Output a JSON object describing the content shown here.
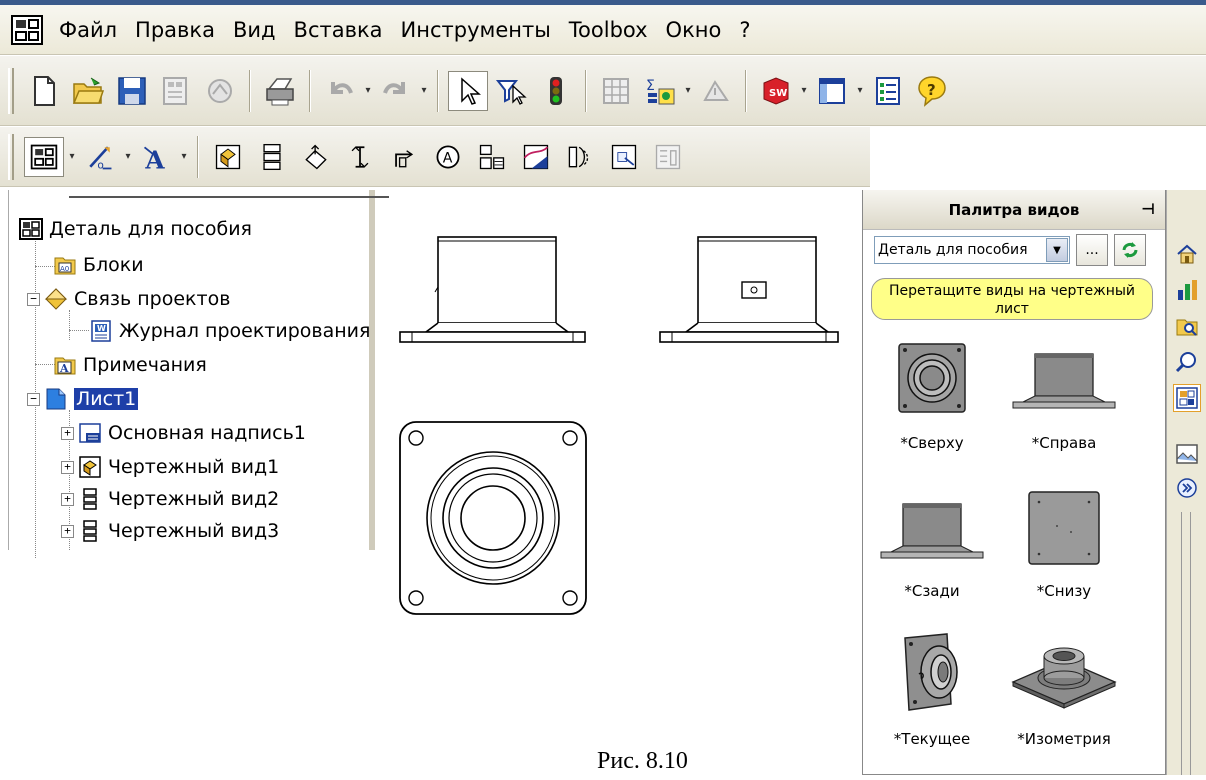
{
  "menu": {
    "items": [
      "Файл",
      "Правка",
      "Вид",
      "Вставка",
      "Инструменты",
      "Toolbox",
      "Окно",
      "?"
    ]
  },
  "toolbar_main": {
    "icons": [
      "new-document-icon",
      "open-folder-icon",
      "save-icon",
      "print-setup-icon",
      "publish-icon",
      "print-icon",
      "undo-icon",
      "redo-icon",
      "select-arrow-icon",
      "selection-filter-icon",
      "traffic-light-icon",
      "grid-icon",
      "equation-icon",
      "rebuild-icon",
      "solidworks-icon",
      "window-icon",
      "options-icon",
      "help-icon"
    ]
  },
  "toolbar_drawing": {
    "icons": [
      "drawing-sheet-icon",
      "line-format-icon",
      "text-format-icon",
      "model-view-icon",
      "standard-3-view-icon",
      "projected-view-icon",
      "auxiliary-view-icon",
      "section-view-icon",
      "detail-view-icon",
      "broken-out-icon",
      "crop-view-icon",
      "alternate-position-icon",
      "predefined-view-icon",
      "empty-view-icon"
    ]
  },
  "tree": {
    "root": "Деталь для пособия",
    "items": [
      {
        "label": "Блоки",
        "icon": "blocks-icon"
      },
      {
        "label": "Связь проектов",
        "icon": "design-binder-icon"
      },
      {
        "label": "Журнал проектирования",
        "icon": "design-journal-icon"
      },
      {
        "label": "Примечания",
        "icon": "annotations-icon"
      },
      {
        "label": "Лист1",
        "icon": "sheet-icon"
      },
      {
        "label": "Основная надпись1",
        "icon": "title-block-icon"
      },
      {
        "label": "Чертежный вид1",
        "icon": "drawing-view-icon"
      },
      {
        "label": "Чертежный вид2",
        "icon": "drawing-view-icon"
      },
      {
        "label": "Чертежный вид3",
        "icon": "drawing-view-icon"
      }
    ]
  },
  "palette": {
    "title": "Палитра видов",
    "selected_document": "Деталь для пособия",
    "browse_label": "...",
    "tip": "Перетащите виды на чертежный лист",
    "views": [
      "*Сверху",
      "*Справа",
      "*Сзади",
      "*Снизу",
      "*Текущее",
      "*Изометрия"
    ]
  },
  "sidebar_tabs": [
    "home-icon",
    "resources-icon",
    "file-explorer-icon",
    "search-icon",
    "view-palette-icon",
    "appearances-icon",
    "expand-icon"
  ],
  "caption": "Рис. 8.10"
}
